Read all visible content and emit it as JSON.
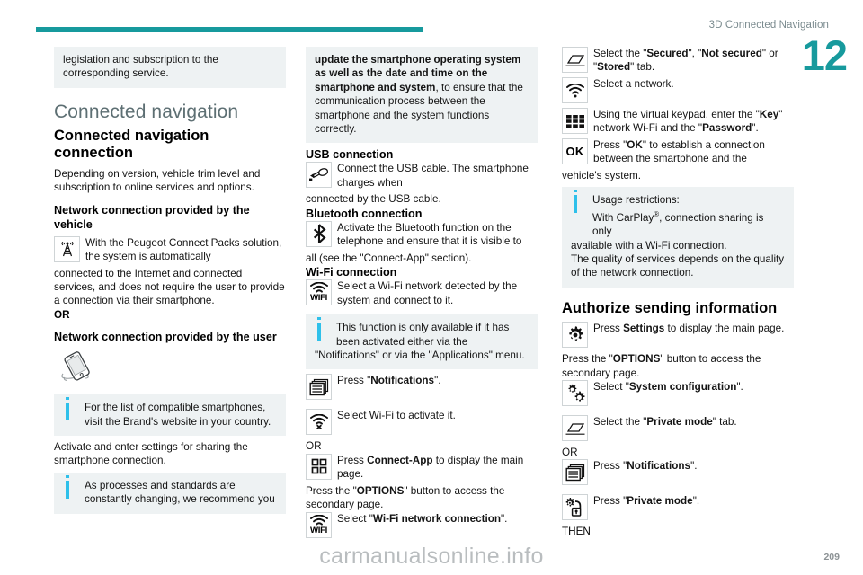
{
  "header": {
    "title": "3D Connected Navigation",
    "chapter_number": "12"
  },
  "footer": {
    "watermark": "carmanualsonline.info",
    "page_number": "209"
  },
  "column1": {
    "continued_note": "legislation and subscription to the corresponding service.",
    "section_title": "Connected navigation",
    "subsection_title": "Connected navigation connection",
    "intro": "Depending on version, vehicle trim level and subscription to online services and options.",
    "heading_vehicle": "Network connection provided by the vehicle",
    "vehicle_text_a": "With the Peugeot Connect Packs solution, the system is automatically",
    "vehicle_text_b": "connected to the Internet and connected services, and does not require the user to provide a connection via their smartphone.",
    "or_label": "OR",
    "heading_user": "Network connection provided by the user",
    "note_compatible": "For the list of compatible smartphones, visit the Brand's website in your country.",
    "activate_text": "Activate and enter settings for sharing the smartphone connection.",
    "note_processes": "As processes and standards are constantly changing, we recommend you",
    "icons": {
      "antenna": "antenna-tower-icon",
      "smartphone": "smartphone-icon"
    }
  },
  "column2": {
    "continued_note_bold": "update the smartphone operating system as well as the date and time on the smartphone and system",
    "continued_note_rest": ", to ensure that the communication process between the smartphone and the system functions correctly.",
    "usb_heading": "USB connection",
    "usb_text_a": "Connect the USB cable. The smartphone charges when",
    "usb_text_b": "connected by the USB cable.",
    "bt_heading": "Bluetooth connection",
    "bt_text_a": "Activate the Bluetooth function on the telephone and ensure that it is visible to",
    "bt_text_b": "all (see the \"Connect-App\" section).",
    "wifi_heading": "Wi-Fi connection",
    "wifi_text": "Select a Wi-Fi network detected by the system and connect to it.",
    "note_activated_a": "This function is only available if it has been activated either via the",
    "note_activated_b": "\"Notifications\" or via the \"Applications\" menu.",
    "press_notifications_pre": "Press \"",
    "press_notifications_bold": "Notifications",
    "press_notifications_post": "\".",
    "select_wifi_activate": "Select Wi-Fi to activate it.",
    "or_label": "OR",
    "connect_app_pre": "Press ",
    "connect_app_bold": "Connect-App",
    "connect_app_post": " to display the main page.",
    "options_pre": "Press the \"",
    "options_bold": "OPTIONS",
    "options_post": "\" button to access the secondary page.",
    "select_wifi_network_pre": "Select \"",
    "select_wifi_network_bold": "Wi-Fi network connection",
    "select_wifi_network_post": "\".",
    "icons": {
      "usb": "usb-cable-icon",
      "bluetooth": "bluetooth-icon",
      "wifi": "wifi-icon",
      "notifications": "notifications-icon",
      "wifi_off": "wifi-off-icon",
      "apps": "apps-grid-icon",
      "wifi_label": "WIFI"
    }
  },
  "column3": {
    "select_tab_pre": "Select the \"",
    "select_tab_b1": "Secured",
    "select_tab_mid1": "\", \"",
    "select_tab_b2": "Not secured",
    "select_tab_mid2": "\" or \"",
    "select_tab_b3": "Stored",
    "select_tab_post": "\" tab.",
    "select_network": "Select a network.",
    "keypad_pre": "Using the virtual keypad, enter the \"",
    "keypad_b1": "Key",
    "keypad_mid": "\" network Wi-Fi and the \"",
    "keypad_b2": "Password",
    "keypad_post": "\".",
    "ok_pre": "Press \"",
    "ok_b": "OK",
    "ok_post": "\" to establish a connection between the smartphone and the",
    "ok_tail": "vehicle's system.",
    "note_usage_title": "Usage restrictions:",
    "note_usage_a": "With CarPlay",
    "note_usage_sup": "®",
    "note_usage_b": ", connection sharing is only",
    "note_usage_c": "available with a Wi-Fi connection.",
    "note_usage_d": "The quality of services depends on the quality of the network connection.",
    "authorize_heading": "Authorize sending information",
    "settings_pre": "Press ",
    "settings_bold": "Settings",
    "settings_post": " to display the main page.",
    "options_pre": "Press the \"",
    "options_bold": "OPTIONS",
    "options_post": "\" button to access the secondary page.",
    "sysconfig_pre": "Select \"",
    "sysconfig_bold": "System configuration",
    "sysconfig_post": "\".",
    "private_tab_pre": "Select the \"",
    "private_tab_bold": "Private mode",
    "private_tab_post": "\" tab.",
    "or_label": "OR",
    "press_notifications_pre": "Press \"",
    "press_notifications_bold": "Notifications",
    "press_notifications_post": "\".",
    "press_private_pre": "Press \"",
    "press_private_bold": "Private mode",
    "press_private_post": "\".",
    "then_label": "THEN",
    "icons": {
      "tab": "tab-sheet-icon",
      "wifi": "wifi-icon",
      "keypad": "keypad-grid-icon",
      "ok": "OK",
      "settings": "settings-gear-icon",
      "sysconfig": "system-config-gears-icon",
      "notifications": "notifications-icon",
      "private_mode": "private-mode-lock-icon"
    }
  },
  "colors": {
    "accent_teal": "#179a9d",
    "note_bg": "#eef2f3",
    "info_blue": "#2ec0ea",
    "heading_grey": "#5d6f73"
  }
}
